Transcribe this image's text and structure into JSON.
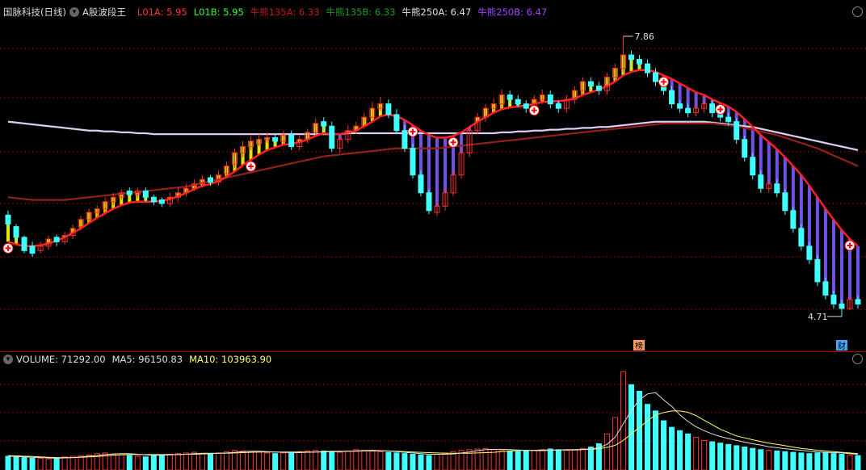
{
  "header": {
    "stock_name": "国脉科技(日线)",
    "indicator_name": "A股波段王",
    "items": [
      {
        "label": "L01A: 5.95",
        "color": "#ff3030"
      },
      {
        "label": "L01B: 5.95",
        "color": "#30ff30"
      },
      {
        "label": "牛熊135A: 6.33",
        "color": "#c01818"
      },
      {
        "label": "牛熊135B: 6.33",
        "color": "#1a9a1a"
      },
      {
        "label": "牛熊250A: 6.47",
        "color": "#e0e0e0"
      },
      {
        "label": "牛熊250B: 6.47",
        "color": "#a040ff"
      }
    ]
  },
  "volume_header": {
    "items": [
      {
        "label": "VOLUME: 71292.00",
        "color": "#e0e0e0"
      },
      {
        "label": "MA5: 96150.83",
        "color": "#e0e0e0"
      },
      {
        "label": "MA10: 103963.90",
        "color": "#ffff66"
      }
    ]
  },
  "annotations": {
    "high_label": "7.86",
    "low_label": "4.71",
    "badge_bang": "榜",
    "badge_cai": "财"
  },
  "colors": {
    "up": "#ff3030",
    "down": "#40ffff",
    "yellow_bar": "#ffff00",
    "purple_bar": "#7c5cff",
    "l01_red": "#ff2020",
    "l01_green": "#40ee40",
    "bull135_dark": "#a01818",
    "bull135_green": "#1e9a28",
    "bull250_white": "#d8d8d8",
    "bull250_purple": "#8a2be2",
    "ma10_line": "#ffff66",
    "ma5_line": "#e0e0e0",
    "marker": "#ffffff",
    "grid": "#8b0000"
  },
  "chart_data": {
    "type": "candlestick",
    "title": "国脉科技(日线)",
    "price_ylim": [
      4.4,
      8.05
    ],
    "price_high": 7.86,
    "price_low": 4.71,
    "close": [
      5.75,
      5.6,
      5.45,
      5.42,
      5.5,
      5.58,
      5.55,
      5.62,
      5.7,
      5.8,
      5.88,
      5.92,
      6.0,
      6.05,
      6.1,
      6.08,
      6.12,
      6.05,
      6.0,
      5.98,
      6.05,
      6.1,
      6.15,
      6.2,
      6.25,
      6.22,
      6.3,
      6.4,
      6.55,
      6.62,
      6.68,
      6.7,
      6.72,
      6.68,
      6.75,
      6.62,
      6.7,
      6.78,
      6.88,
      6.85,
      6.6,
      6.7,
      6.8,
      6.85,
      6.95,
      7.05,
      7.1,
      6.98,
      6.8,
      6.6,
      6.3,
      6.1,
      5.9,
      5.95,
      6.1,
      6.3,
      6.55,
      6.8,
      6.95,
      7.05,
      7.1,
      7.2,
      7.15,
      7.1,
      7.05,
      7.15,
      7.2,
      7.1,
      7.05,
      7.15,
      7.25,
      7.35,
      7.3,
      7.25,
      7.4,
      7.5,
      7.65,
      7.6,
      7.55,
      7.45,
      7.35,
      7.25,
      7.1,
      7.05,
      7.0,
      7.05,
      7.1,
      7.0,
      6.95,
      6.9,
      6.7,
      6.5,
      6.3,
      6.15,
      6.2,
      6.1,
      5.9,
      5.7,
      5.5,
      5.35,
      5.1,
      4.95,
      4.85,
      4.8,
      4.9,
      4.85
    ],
    "open": [
      5.85,
      5.72,
      5.6,
      5.5,
      5.45,
      5.5,
      5.6,
      5.55,
      5.62,
      5.72,
      5.8,
      5.88,
      5.92,
      6.0,
      6.05,
      6.12,
      6.08,
      6.12,
      6.05,
      6.02,
      5.98,
      6.05,
      6.1,
      6.15,
      6.2,
      6.27,
      6.22,
      6.32,
      6.42,
      6.55,
      6.62,
      6.65,
      6.7,
      6.72,
      6.68,
      6.75,
      6.62,
      6.7,
      6.78,
      6.9,
      6.85,
      6.6,
      6.7,
      6.8,
      6.85,
      6.95,
      7.05,
      7.1,
      6.98,
      6.8,
      6.6,
      6.3,
      6.1,
      5.88,
      5.95,
      6.1,
      6.3,
      6.55,
      6.8,
      6.95,
      7.05,
      7.1,
      7.2,
      7.15,
      7.1,
      7.05,
      7.15,
      7.2,
      7.1,
      7.05,
      7.15,
      7.25,
      7.35,
      7.3,
      7.25,
      7.4,
      7.5,
      7.65,
      7.6,
      7.55,
      7.45,
      7.35,
      7.25,
      7.1,
      7.05,
      7.0,
      7.05,
      7.1,
      7.0,
      6.95,
      6.9,
      6.7,
      6.5,
      6.3,
      6.15,
      6.2,
      6.1,
      5.9,
      5.7,
      5.5,
      5.35,
      5.1,
      4.95,
      4.85,
      4.8,
      4.9
    ],
    "high": [
      5.9,
      5.75,
      5.62,
      5.55,
      5.55,
      5.62,
      5.63,
      5.66,
      5.74,
      5.84,
      5.92,
      5.96,
      6.05,
      6.1,
      6.14,
      6.16,
      6.16,
      6.16,
      6.08,
      6.05,
      6.1,
      6.16,
      6.2,
      6.25,
      6.3,
      6.3,
      6.35,
      6.45,
      6.6,
      6.68,
      6.74,
      6.76,
      6.78,
      6.76,
      6.8,
      6.8,
      6.74,
      6.82,
      6.94,
      6.95,
      6.9,
      6.75,
      6.86,
      6.9,
      7.0,
      7.12,
      7.18,
      7.15,
      7.04,
      6.86,
      6.65,
      6.35,
      6.14,
      6.0,
      6.15,
      6.35,
      6.6,
      6.85,
      7.0,
      7.1,
      7.16,
      7.26,
      7.25,
      7.2,
      7.14,
      7.2,
      7.26,
      7.25,
      7.14,
      7.2,
      7.3,
      7.4,
      7.4,
      7.35,
      7.45,
      7.55,
      7.86,
      7.7,
      7.65,
      7.6,
      7.5,
      7.4,
      7.3,
      7.14,
      7.1,
      7.1,
      7.15,
      7.14,
      7.05,
      7.0,
      6.94,
      6.74,
      6.55,
      6.35,
      6.25,
      6.25,
      6.14,
      5.94,
      5.75,
      5.55,
      5.4,
      5.15,
      5.0,
      4.9,
      4.95,
      4.94
    ],
    "low": [
      5.7,
      5.55,
      5.42,
      5.38,
      5.42,
      5.46,
      5.5,
      5.52,
      5.58,
      5.68,
      5.76,
      5.84,
      5.88,
      5.96,
      6.02,
      6.04,
      6.04,
      6.0,
      5.96,
      5.94,
      5.94,
      6.0,
      6.06,
      6.12,
      6.16,
      6.18,
      6.18,
      6.28,
      6.38,
      6.5,
      6.58,
      6.62,
      6.66,
      6.64,
      6.64,
      6.58,
      6.58,
      6.66,
      6.74,
      6.8,
      6.56,
      6.55,
      6.66,
      6.76,
      6.82,
      6.92,
      7.02,
      6.94,
      6.76,
      6.56,
      6.26,
      6.06,
      5.86,
      5.84,
      5.9,
      6.06,
      6.26,
      6.5,
      6.76,
      6.9,
      7.0,
      7.06,
      7.1,
      7.06,
      7.0,
      7.0,
      7.1,
      7.05,
      7.0,
      7.0,
      7.1,
      7.2,
      7.25,
      7.2,
      7.2,
      7.35,
      7.45,
      7.5,
      7.5,
      7.4,
      7.3,
      7.2,
      7.05,
      7.0,
      6.95,
      6.96,
      7.0,
      6.95,
      6.9,
      6.85,
      6.65,
      6.45,
      6.25,
      6.1,
      6.1,
      6.05,
      5.85,
      5.65,
      5.45,
      5.3,
      5.05,
      4.9,
      4.8,
      4.71,
      4.78,
      4.8
    ],
    "volume": [
      42,
      40,
      38,
      36,
      35,
      34,
      36,
      40,
      42,
      44,
      46,
      50,
      52,
      48,
      46,
      44,
      42,
      40,
      44,
      46,
      48,
      50,
      52,
      54,
      50,
      48,
      52,
      56,
      60,
      58,
      56,
      54,
      52,
      50,
      52,
      54,
      56,
      58,
      60,
      58,
      56,
      54,
      58,
      62,
      60,
      58,
      56,
      54,
      52,
      50,
      48,
      46,
      44,
      48,
      52,
      56,
      60,
      62,
      64,
      66,
      62,
      60,
      58,
      56,
      58,
      60,
      62,
      64,
      62,
      60,
      62,
      66,
      70,
      80,
      110,
      160,
      300,
      260,
      240,
      200,
      180,
      150,
      130,
      120,
      110,
      100,
      90,
      86,
      82,
      78,
      74,
      70,
      66,
      62,
      60,
      58,
      56,
      54,
      52,
      50,
      52,
      54,
      50,
      48,
      46,
      44
    ],
    "ma5": [
      42,
      41,
      40,
      39,
      38,
      37,
      36,
      37,
      38,
      40,
      42,
      44,
      47,
      49,
      50,
      50,
      48,
      46,
      45,
      45,
      46,
      47,
      48,
      50,
      51,
      51,
      51,
      52,
      54,
      56,
      57,
      57,
      56,
      55,
      54,
      53,
      53,
      54,
      55,
      56,
      57,
      57,
      57,
      58,
      59,
      60,
      59,
      58,
      56,
      54,
      52,
      50,
      48,
      48,
      48,
      49,
      52,
      55,
      59,
      62,
      63,
      63,
      62,
      61,
      60,
      59,
      59,
      60,
      61,
      62,
      62,
      63,
      64,
      68,
      78,
      100,
      140,
      182,
      214,
      232,
      236,
      214,
      194,
      168,
      148,
      132,
      120,
      110,
      102,
      96,
      90,
      85,
      80,
      76,
      71,
      68,
      65,
      62,
      60,
      57,
      55,
      54,
      53,
      52,
      50,
      48
    ],
    "ma10": [
      44,
      43,
      42,
      41,
      40,
      39,
      38,
      38,
      38,
      39,
      40,
      41,
      43,
      45,
      46,
      47,
      47,
      47,
      47,
      47,
      47,
      47,
      48,
      48,
      49,
      50,
      51,
      51,
      52,
      53,
      54,
      55,
      55,
      55,
      55,
      55,
      55,
      55,
      55,
      55,
      56,
      56,
      57,
      57,
      58,
      58,
      58,
      58,
      57,
      56,
      55,
      54,
      53,
      52,
      51,
      51,
      51,
      51,
      52,
      53,
      54,
      56,
      58,
      59,
      60,
      60,
      61,
      61,
      61,
      61,
      61,
      62,
      63,
      65,
      69,
      75,
      90,
      110,
      130,
      150,
      168,
      175,
      180,
      180,
      176,
      166,
      152,
      138,
      124,
      114,
      104,
      98,
      92,
      87,
      82,
      78,
      74,
      70,
      66,
      63,
      60,
      58,
      56,
      54,
      52,
      50
    ],
    "l01": [
      5.55,
      5.52,
      5.5,
      5.5,
      5.51,
      5.53,
      5.56,
      5.6,
      5.65,
      5.7,
      5.76,
      5.82,
      5.87,
      5.92,
      5.96,
      5.99,
      6.0,
      6.0,
      6.0,
      6.01,
      6.03,
      6.06,
      6.1,
      6.14,
      6.18,
      6.2,
      6.23,
      6.28,
      6.34,
      6.41,
      6.47,
      6.53,
      6.58,
      6.61,
      6.64,
      6.65,
      6.67,
      6.7,
      6.74,
      6.77,
      6.76,
      6.76,
      6.78,
      6.8,
      6.85,
      6.9,
      6.96,
      6.98,
      6.96,
      6.92,
      6.86,
      6.8,
      6.75,
      6.72,
      6.72,
      6.74,
      6.78,
      6.84,
      6.9,
      6.95,
      7.0,
      7.04,
      7.06,
      7.07,
      7.08,
      7.1,
      7.12,
      7.13,
      7.13,
      7.14,
      7.16,
      7.2,
      7.23,
      7.26,
      7.3,
      7.35,
      7.42,
      7.46,
      7.48,
      7.48,
      7.46,
      7.42,
      7.38,
      7.33,
      7.28,
      7.23,
      7.2,
      7.15,
      7.11,
      7.07,
      7.01,
      6.93,
      6.84,
      6.75,
      6.67,
      6.59,
      6.5,
      6.4,
      6.3,
      6.18,
      6.05,
      5.92,
      5.8,
      5.68,
      5.58,
      5.5
    ],
    "bull135": [
      6.05,
      6.04,
      6.03,
      6.02,
      6.02,
      6.02,
      6.02,
      6.02,
      6.03,
      6.04,
      6.05,
      6.06,
      6.07,
      6.08,
      6.09,
      6.1,
      6.11,
      6.12,
      6.13,
      6.14,
      6.15,
      6.16,
      6.17,
      6.19,
      6.21,
      6.23,
      6.25,
      6.27,
      6.29,
      6.31,
      6.33,
      6.35,
      6.37,
      6.39,
      6.41,
      6.43,
      6.45,
      6.47,
      6.49,
      6.51,
      6.52,
      6.53,
      6.54,
      6.55,
      6.56,
      6.57,
      6.58,
      6.59,
      6.6,
      6.6,
      6.6,
      6.6,
      6.6,
      6.6,
      6.61,
      6.62,
      6.63,
      6.64,
      6.65,
      6.66,
      6.67,
      6.68,
      6.69,
      6.7,
      6.71,
      6.72,
      6.73,
      6.74,
      6.75,
      6.76,
      6.77,
      6.78,
      6.79,
      6.8,
      6.81,
      6.82,
      6.83,
      6.84,
      6.85,
      6.86,
      6.87,
      6.88,
      6.88,
      6.88,
      6.88,
      6.88,
      6.88,
      6.88,
      6.87,
      6.86,
      6.85,
      6.83,
      6.81,
      6.79,
      6.77,
      6.75,
      6.72,
      6.69,
      6.66,
      6.63,
      6.6,
      6.56,
      6.52,
      6.48,
      6.44,
      6.4
    ],
    "bull250": [
      6.9,
      6.89,
      6.88,
      6.87,
      6.86,
      6.85,
      6.84,
      6.83,
      6.82,
      6.81,
      6.8,
      6.8,
      6.79,
      6.79,
      6.78,
      6.78,
      6.77,
      6.77,
      6.76,
      6.76,
      6.76,
      6.76,
      6.76,
      6.76,
      6.76,
      6.76,
      6.76,
      6.76,
      6.76,
      6.76,
      6.76,
      6.76,
      6.76,
      6.76,
      6.76,
      6.76,
      6.76,
      6.76,
      6.76,
      6.76,
      6.76,
      6.76,
      6.77,
      6.77,
      6.77,
      6.77,
      6.77,
      6.77,
      6.77,
      6.77,
      6.77,
      6.77,
      6.77,
      6.77,
      6.77,
      6.77,
      6.77,
      6.77,
      6.77,
      6.77,
      6.77,
      6.78,
      6.78,
      6.79,
      6.79,
      6.8,
      6.8,
      6.81,
      6.81,
      6.82,
      6.82,
      6.83,
      6.83,
      6.84,
      6.84,
      6.85,
      6.86,
      6.87,
      6.88,
      6.89,
      6.9,
      6.9,
      6.9,
      6.9,
      6.9,
      6.9,
      6.9,
      6.89,
      6.88,
      6.87,
      6.86,
      6.85,
      6.84,
      6.82,
      6.8,
      6.78,
      6.76,
      6.74,
      6.72,
      6.7,
      6.68,
      6.66,
      6.64,
      6.62,
      6.6,
      6.58
    ],
    "marker_bars": [
      0,
      30,
      50,
      55,
      65,
      81,
      81,
      88,
      104
    ],
    "ylim_volume": [
      0,
      320
    ]
  }
}
